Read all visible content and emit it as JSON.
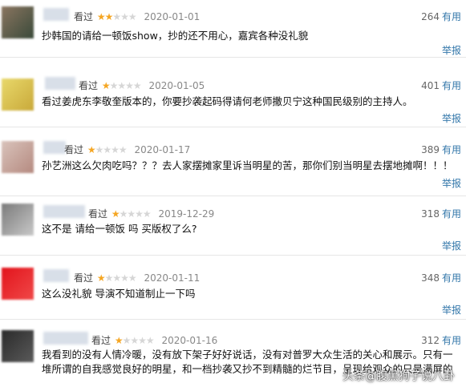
{
  "watched_label": "看过",
  "useful_label": "有用",
  "report_label": "举报",
  "watermark": "头条@腹黑狗子说八卦",
  "colors": {
    "link": "#3377aa",
    "star": "#f5a623",
    "divider": "#e6e6e6"
  },
  "reviews": [
    {
      "rating": 2,
      "date": "2020-01-01",
      "votes": "264",
      "content": "抄韩国的请给一顿饭show，抄的还不用心，嘉宾各种没礼貌",
      "avatar_colors": [
        "#8a7560",
        "#3a4a3a"
      ]
    },
    {
      "rating": 1,
      "date": "2020-01-05",
      "votes": "401",
      "content": "看过姜虎东李敬奎版本的，你要抄袭起码得请何老师撒贝宁这种国民级别的主持人。",
      "avatar_colors": [
        "#e8d86a",
        "#c9a93a"
      ]
    },
    {
      "rating": 1,
      "date": "2020-01-17",
      "votes": "389",
      "content": "孙艺洲这么欠肉吃吗？？？去人家摆摊家里诉当明星的苦，那你们别当明星去摆地摊啊！！！",
      "avatar_colors": [
        "#d9c3bb",
        "#b58a80"
      ]
    },
    {
      "rating": 1,
      "date": "2019-12-29",
      "votes": "318",
      "content": "这不是 请给一顿饭 吗 买版权了么?",
      "avatar_colors": [
        "#7a7a7a",
        "#c8c8c8"
      ]
    },
    {
      "rating": 1,
      "date": "2020-01-11",
      "votes": "348",
      "content": "这么没礼貌 导演不知道制止一下吗",
      "avatar_colors": [
        "#e2141c",
        "#f04848"
      ]
    },
    {
      "rating": 1,
      "date": "2020-01-16",
      "votes": "312",
      "content": "我看到的没有人情冷暖，没有放下架子好好说话，没有对普罗大众生活的关心和展示。只有一堆所谓的自我感觉良好的明星，和一档抄袭又抄不到精髓的烂节目，呈现给观众的只是满屏的尬。",
      "avatar_colors": [
        "#2a2a2a",
        "#5a5a5a"
      ]
    }
  ]
}
